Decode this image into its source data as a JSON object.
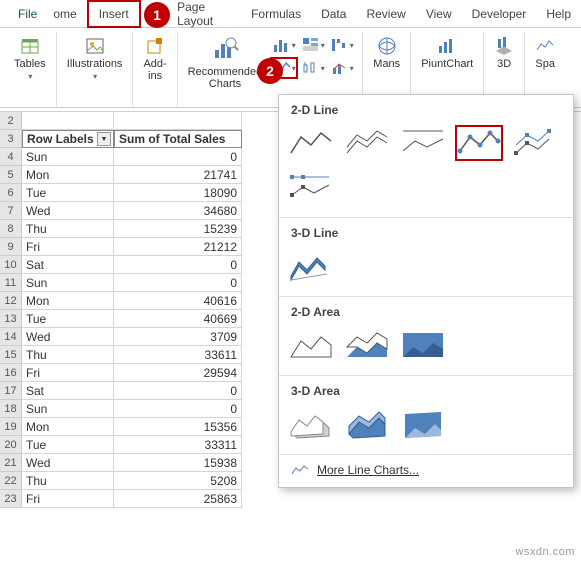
{
  "tabs": {
    "file": "File",
    "insert": "Insert",
    "page_layout": "Page Layout",
    "formulas": "Formulas",
    "data": "Data",
    "review": "Review",
    "view": "View",
    "developer": "Developer",
    "help": "Help",
    "home_partial": "ome"
  },
  "ribbon": {
    "tables": "Tables",
    "illustrations": "Illustrations",
    "addins": "Add-\nins",
    "rec_charts": "Recommended\nCharts",
    "maps_partial": "Mans",
    "pivotchart_partial": "PiuntChart",
    "threeD_partial": "3D",
    "spa_partial": "Spa"
  },
  "grid": {
    "headers": {
      "a": "Row Labels",
      "b": "Sum of Total Sales"
    },
    "rows": [
      {
        "n": 2,
        "a": "",
        "b": ""
      },
      {
        "n": 3,
        "a": "",
        "b": ""
      },
      {
        "n": 4,
        "a": "Sun",
        "b": "0"
      },
      {
        "n": 5,
        "a": "Mon",
        "b": "21741"
      },
      {
        "n": 6,
        "a": "Tue",
        "b": "18090"
      },
      {
        "n": 7,
        "a": "Wed",
        "b": "34680"
      },
      {
        "n": 8,
        "a": "Thu",
        "b": "15239"
      },
      {
        "n": 9,
        "a": "Fri",
        "b": "21212"
      },
      {
        "n": 10,
        "a": "Sat",
        "b": "0"
      },
      {
        "n": 11,
        "a": "Sun",
        "b": "0"
      },
      {
        "n": 12,
        "a": "Mon",
        "b": "40616"
      },
      {
        "n": 13,
        "a": "Tue",
        "b": "40669"
      },
      {
        "n": 14,
        "a": "Wed",
        "b": "3709"
      },
      {
        "n": 15,
        "a": "Thu",
        "b": "33611"
      },
      {
        "n": 16,
        "a": "Fri",
        "b": "29594"
      },
      {
        "n": 17,
        "a": "Sat",
        "b": "0"
      },
      {
        "n": 18,
        "a": "Sun",
        "b": "0"
      },
      {
        "n": 19,
        "a": "Mon",
        "b": "15356"
      },
      {
        "n": 20,
        "a": "Tue",
        "b": "33311"
      },
      {
        "n": 21,
        "a": "Wed",
        "b": "15938"
      },
      {
        "n": 22,
        "a": "Thu",
        "b": "5208"
      },
      {
        "n": 23,
        "a": "Fri",
        "b": "25863"
      }
    ]
  },
  "dropdown": {
    "s1": "2-D Line",
    "s2": "3-D Line",
    "s3": "2-D Area",
    "s4": "3-D Area",
    "more": "More Line Charts..."
  },
  "watermark": "wsxdn.com"
}
